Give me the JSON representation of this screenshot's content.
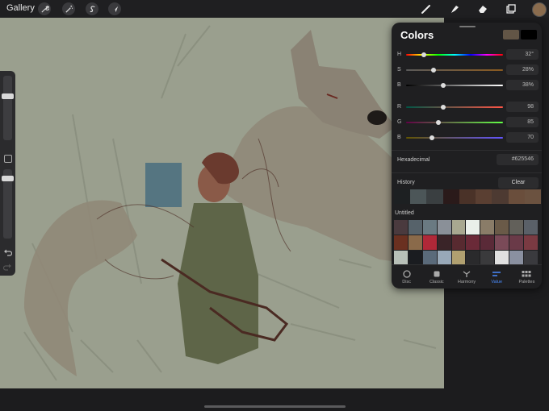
{
  "topbar": {
    "gallery_label": "Gallery",
    "left_tools": [
      "wrench-icon",
      "magic-wand-icon",
      "selection-s-icon",
      "arrow-cursor-icon"
    ],
    "right_tools": [
      "brush-icon",
      "smudge-icon",
      "eraser-icon",
      "layers-icon"
    ],
    "current_color": "#8a6c4e"
  },
  "colors_panel": {
    "title": "Colors",
    "primary_color": "#625546",
    "secondary_color": "#000000",
    "hsb": [
      {
        "label": "H",
        "value": "32°",
        "pos": 0.18,
        "gradient": "linear-gradient(90deg,#f00,#ff0,#0f0,#0ff,#00f,#f0f,#f00)"
      },
      {
        "label": "S",
        "value": "28%",
        "pos": 0.28,
        "gradient": "linear-gradient(90deg,#5a5a5a,#8a5a20)"
      },
      {
        "label": "B",
        "value": "38%",
        "pos": 0.38,
        "gradient": "linear-gradient(90deg,#000,#fff)"
      }
    ],
    "rgb": [
      {
        "label": "R",
        "value": "98",
        "pos": 0.38,
        "gradient": "linear-gradient(90deg,#005546,#ff5546)"
      },
      {
        "label": "G",
        "value": "85",
        "pos": 0.33,
        "gradient": "linear-gradient(90deg,#620046,#62ff46)"
      },
      {
        "label": "B",
        "value": "70",
        "pos": 0.27,
        "gradient": "linear-gradient(90deg,#625500,#6255ff)"
      }
    ],
    "hex_label": "Hexadecimal",
    "hex_value": "#625546",
    "history_label": "History",
    "clear_label": "Clear",
    "history": [
      "#1d2022",
      "#4c5658",
      "#3a3f41",
      "#2a1a1a",
      "#4a3228",
      "#5a3f32",
      "#4d3a32",
      "#6a4e3c",
      "#6b5240"
    ],
    "palette_name": "Untitled",
    "palette": [
      "#4a3a3e",
      "#56626a",
      "#6a7a82",
      "#8a9098",
      "#a8a890",
      "#eaf0ea",
      "#8a7c68",
      "#6a5a48",
      "#62605a",
      "#5a6068",
      "#6a3020",
      "#8a6a4a",
      "#b02838",
      "#3a2428",
      "#582a30",
      "#6a2a38",
      "#5a2a38",
      "#7a4a58",
      "#6a3a48",
      "#7a3a42",
      "#b8c0b8",
      "#1a1c20",
      "#5a6a7a",
      "#98a8b8",
      "#b0a070",
      "#2a2a2c",
      "#3a3a3c",
      "#e0e0e0",
      "#8a90a0",
      "#3a3a3e"
    ],
    "tabs": [
      {
        "label": "Disc",
        "icon": "disc-icon"
      },
      {
        "label": "Classic",
        "icon": "classic-square-icon"
      },
      {
        "label": "Harmony",
        "icon": "harmony-icon"
      },
      {
        "label": "Value",
        "icon": "value-sliders-icon",
        "active": true
      },
      {
        "label": "Palettes",
        "icon": "palettes-grid-icon"
      }
    ]
  },
  "sidebar": {
    "size_slider": 0.1,
    "opacity_slider": 0.1,
    "modify_button": "square-modify-icon",
    "undo": "undo-icon",
    "redo": "redo-icon"
  }
}
